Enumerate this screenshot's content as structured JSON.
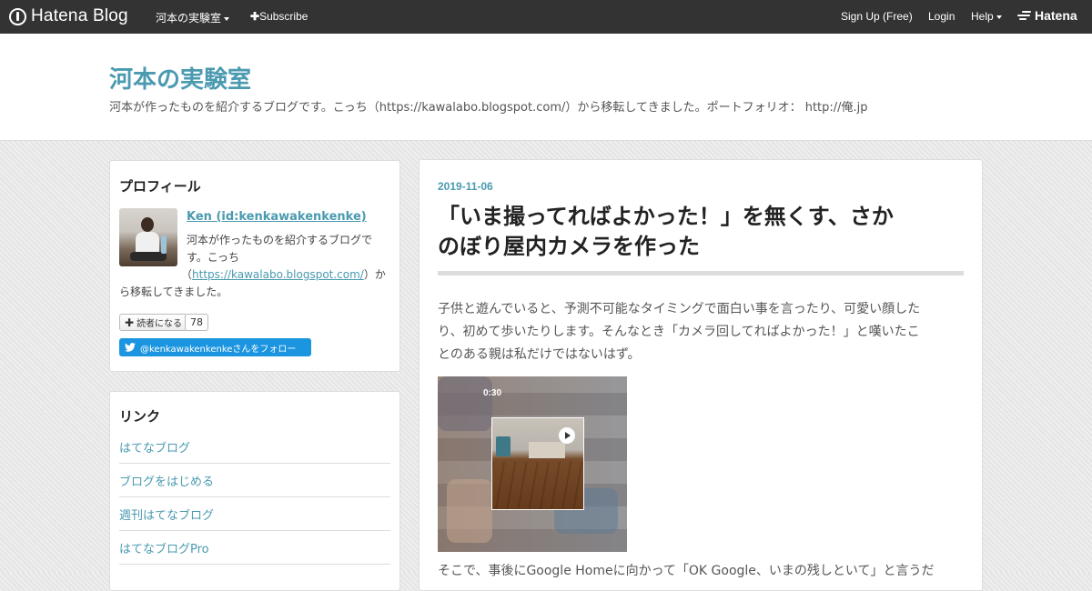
{
  "topbar": {
    "logo_text": "Hatena Blog",
    "blog_menu_label": "河本の実験室",
    "subscribe_label": "Subscribe",
    "signup_label": "Sign Up (Free)",
    "login_label": "Login",
    "help_label": "Help",
    "brand_label": "Hatena"
  },
  "header": {
    "title": "河本の実験室",
    "description": "河本が作ったものを紹介するブログです。こっち（https://kawalabo.blogspot.com/）から移転してきました。ポートフォリオ： http://俺.jp"
  },
  "profile": {
    "heading": "プロフィール",
    "name": "Ken (id:kenkawakenkenke)",
    "desc_line1": "河本が作ったものを紹介するブログで",
    "desc_line2": "す。こっち",
    "desc_open": "（",
    "desc_link": "https://kawalabo.blogspot.com/",
    "desc_after": "）か",
    "desc_line4": "ら移転してきました。",
    "reader_button": "読者になる",
    "reader_count": "78",
    "twitter_follow": "@kenkawakenkenkeさんをフォロー"
  },
  "links": {
    "heading": "リンク",
    "items": [
      "はてなブログ",
      "ブログをはじめる",
      "週刊はてなブログ",
      "はてなブログPro"
    ]
  },
  "entry": {
    "date": "2019-11-06",
    "title_line1": "「いま撮ってればよかった！」を無くす、さか",
    "title_line2": "のぼり屋内カメラを作った",
    "para1_line1": "子供と遊んでいると、予測不可能なタイミングで面白い事を言ったり、可愛い顔した",
    "para1_line2": "り、初めて歩いたりします。そんなとき「カメラ回してればよかった！」と嘆いたこ",
    "para1_line3": "とのある親は私だけではないはず。",
    "video_time": "0:30",
    "para2": "そこで、事後にGoogle Homeに向かって「OK Google、いまの残しといて」と言うだ"
  },
  "colors": {
    "accent": "#4a9ab0",
    "topbar_bg": "#333333",
    "twitter": "#1b95e0"
  }
}
